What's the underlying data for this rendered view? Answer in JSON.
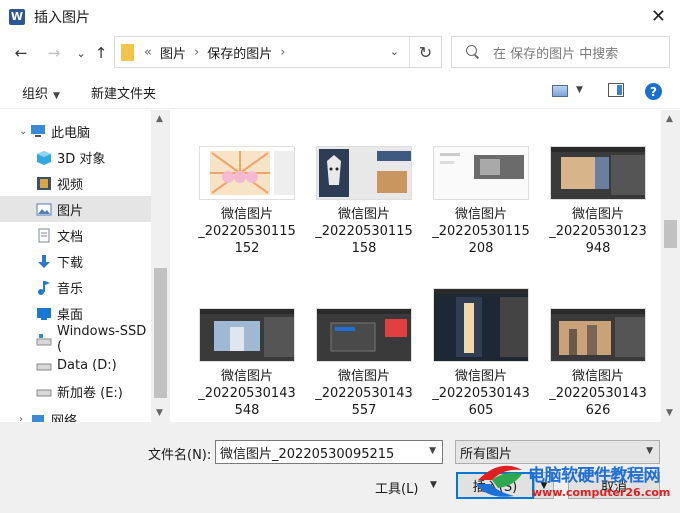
{
  "window": {
    "title": "插入图片",
    "app_icon_letter": "W",
    "close_glyph": "✕"
  },
  "nav": {
    "back_glyph": "←",
    "forward_glyph": "→",
    "recent_glyph": "⌄",
    "up_glyph": "↑",
    "breadcrumb_lead": "«",
    "breadcrumbs": [
      "图片",
      "保存的图片"
    ],
    "breadcrumb_sep": "›",
    "refresh_glyph": "↻",
    "search_placeholder": "在 保存的图片 中搜索"
  },
  "toolbar": {
    "organize_label": "组织",
    "new_folder_label": "新建文件夹",
    "help_glyph": "?"
  },
  "sidebar": {
    "items": [
      {
        "label": "此电脑",
        "icon": "computer-icon",
        "color": "#3a8ad6"
      },
      {
        "label": "3D 对象",
        "icon": "cube-3d-icon",
        "color": "#35a8e0"
      },
      {
        "label": "视频",
        "icon": "video-icon",
        "color": "#3c4f6e"
      },
      {
        "label": "图片",
        "icon": "pictures-icon",
        "color": "#4f7fb8"
      },
      {
        "label": "文档",
        "icon": "document-icon",
        "color": "#7a8aa0"
      },
      {
        "label": "下载",
        "icon": "download-icon",
        "color": "#2f77d6"
      },
      {
        "label": "音乐",
        "icon": "music-icon",
        "color": "#1e7ad6"
      },
      {
        "label": "桌面",
        "icon": "desktop-icon",
        "color": "#1a78d4"
      },
      {
        "label": "Windows-SSD (",
        "icon": "drive-windows-icon",
        "color": "#8a8a8a"
      },
      {
        "label": "Data (D:)",
        "icon": "drive-icon",
        "color": "#8a8a8a"
      },
      {
        "label": "新加卷 (E:)",
        "icon": "drive-icon",
        "color": "#8a8a8a"
      },
      {
        "label": "网络",
        "icon": "network-icon",
        "color": "#3a8ad6"
      }
    ]
  },
  "files": [
    {
      "label": "微信图片\n_20220530115\n152"
    },
    {
      "label": "微信图片\n_20220530115\n158"
    },
    {
      "label": "微信图片\n_20220530115\n208"
    },
    {
      "label": "微信图片\n_20220530123\n948"
    },
    {
      "label": "微信图片\n_20220530143\n548"
    },
    {
      "label": "微信图片\n_20220530143\n557"
    },
    {
      "label": "微信图片\n_20220530143\n605"
    },
    {
      "label": "微信图片\n_20220530143\n626"
    }
  ],
  "footer": {
    "filename_label": "文件名(N):",
    "filename_value": "微信图片_20220530095215",
    "filetype_value": "所有图片",
    "tools_label": "工具(L)",
    "insert_label": "插入(S)",
    "cancel_label": "取消"
  },
  "watermark": {
    "text": "电脑软硬件教程网",
    "url": "www.computer26.com"
  },
  "colors": {
    "accent": "#0078d7",
    "selected_bg": "#e5e5e5"
  }
}
